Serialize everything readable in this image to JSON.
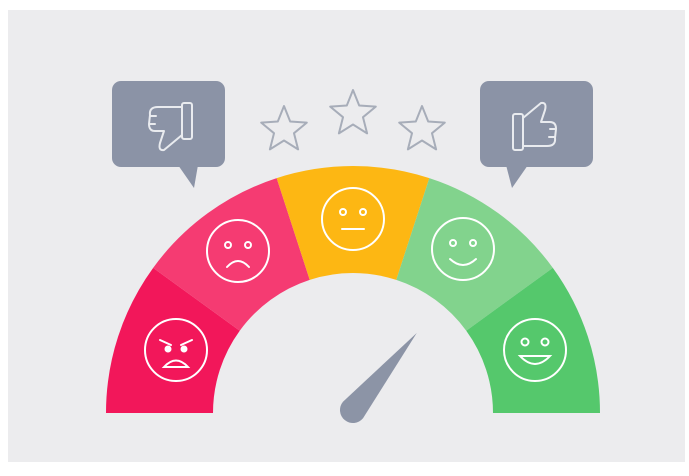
{
  "meter": {
    "segment_colors": [
      "#f2175a",
      "#f53b72",
      "#fdb713",
      "#82d38d",
      "#55c86c"
    ],
    "segment_moods": [
      "angry",
      "sad",
      "neutral",
      "happy",
      "very-happy"
    ],
    "needle_color": "#8c94a6",
    "rating_level_fraction": 0.72
  },
  "feedback": {
    "bubble_color": "#8b93a6",
    "dislike_icon": "thumbs-down-icon",
    "like_icon": "thumbs-up-icon"
  },
  "stars": {
    "count": 3,
    "outline_color": "#a7adb9"
  }
}
